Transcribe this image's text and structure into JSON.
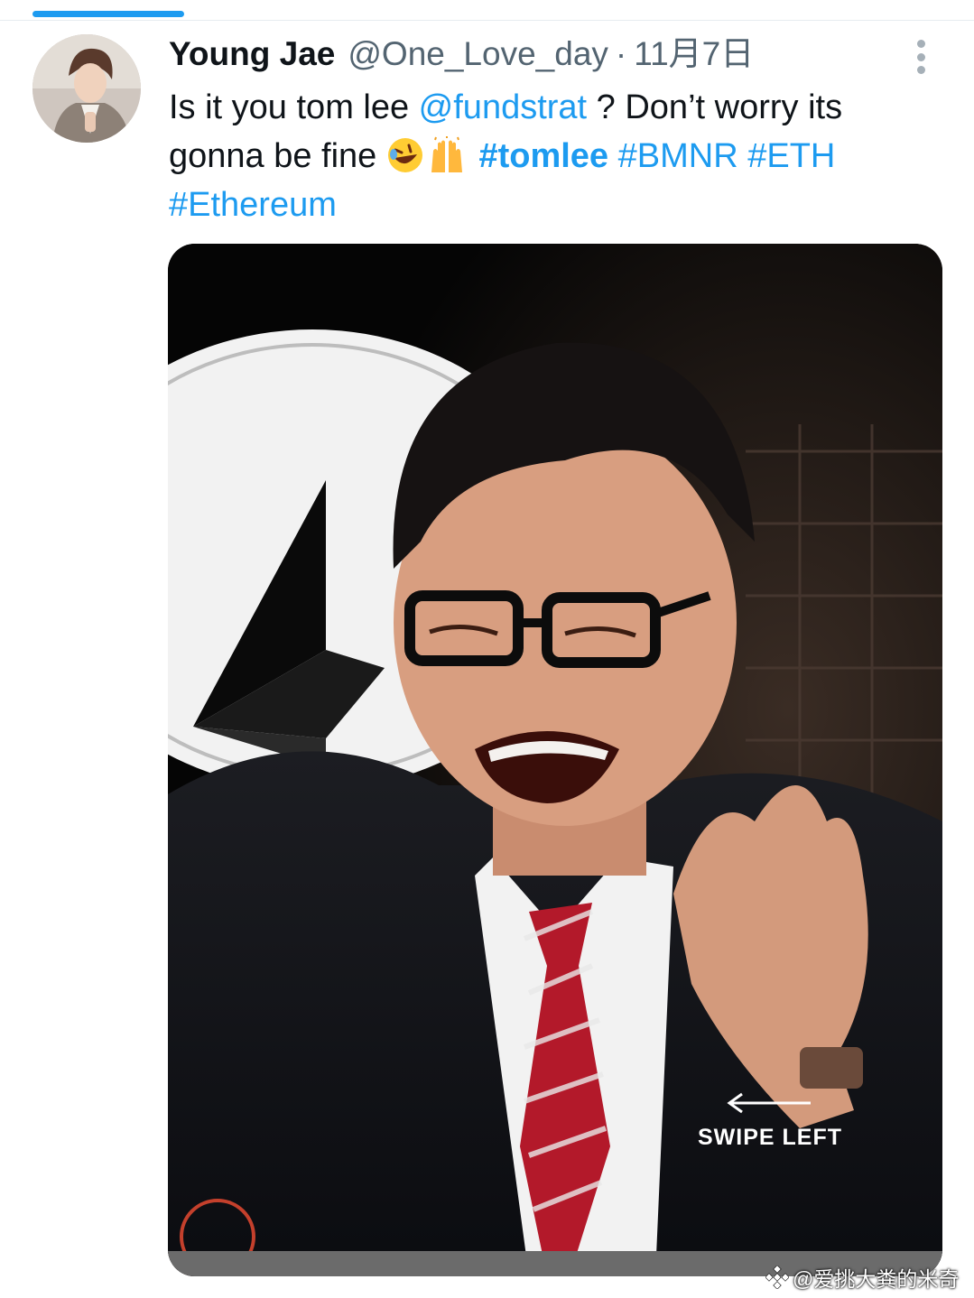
{
  "colors": {
    "accent": "#1d9bf0",
    "text": "#0f1419",
    "secondary": "#536471"
  },
  "tweet": {
    "display_name": "Young Jae",
    "handle": "@One_Love_day",
    "separator": "·",
    "date": "11月7日",
    "text": {
      "part1": "Is it you tom lee ",
      "mention": "@fundstrat",
      "part2": " ? Don’t worry its gonna be fine ",
      "emoji1": "rolling-on-floor-laughing-emoji",
      "emoji2": "raising-hands-emoji",
      "hashtag1": "#tomlee",
      "hashtag2": "#BMNR",
      "hashtag3": "#ETH",
      "hashtag4": "#Ethereum"
    }
  },
  "media": {
    "overlay_text": "SWIPE LEFT",
    "arrow_icon": "left-arrow-icon"
  },
  "watermark": {
    "text": "@爱挑大粪的米奇"
  }
}
